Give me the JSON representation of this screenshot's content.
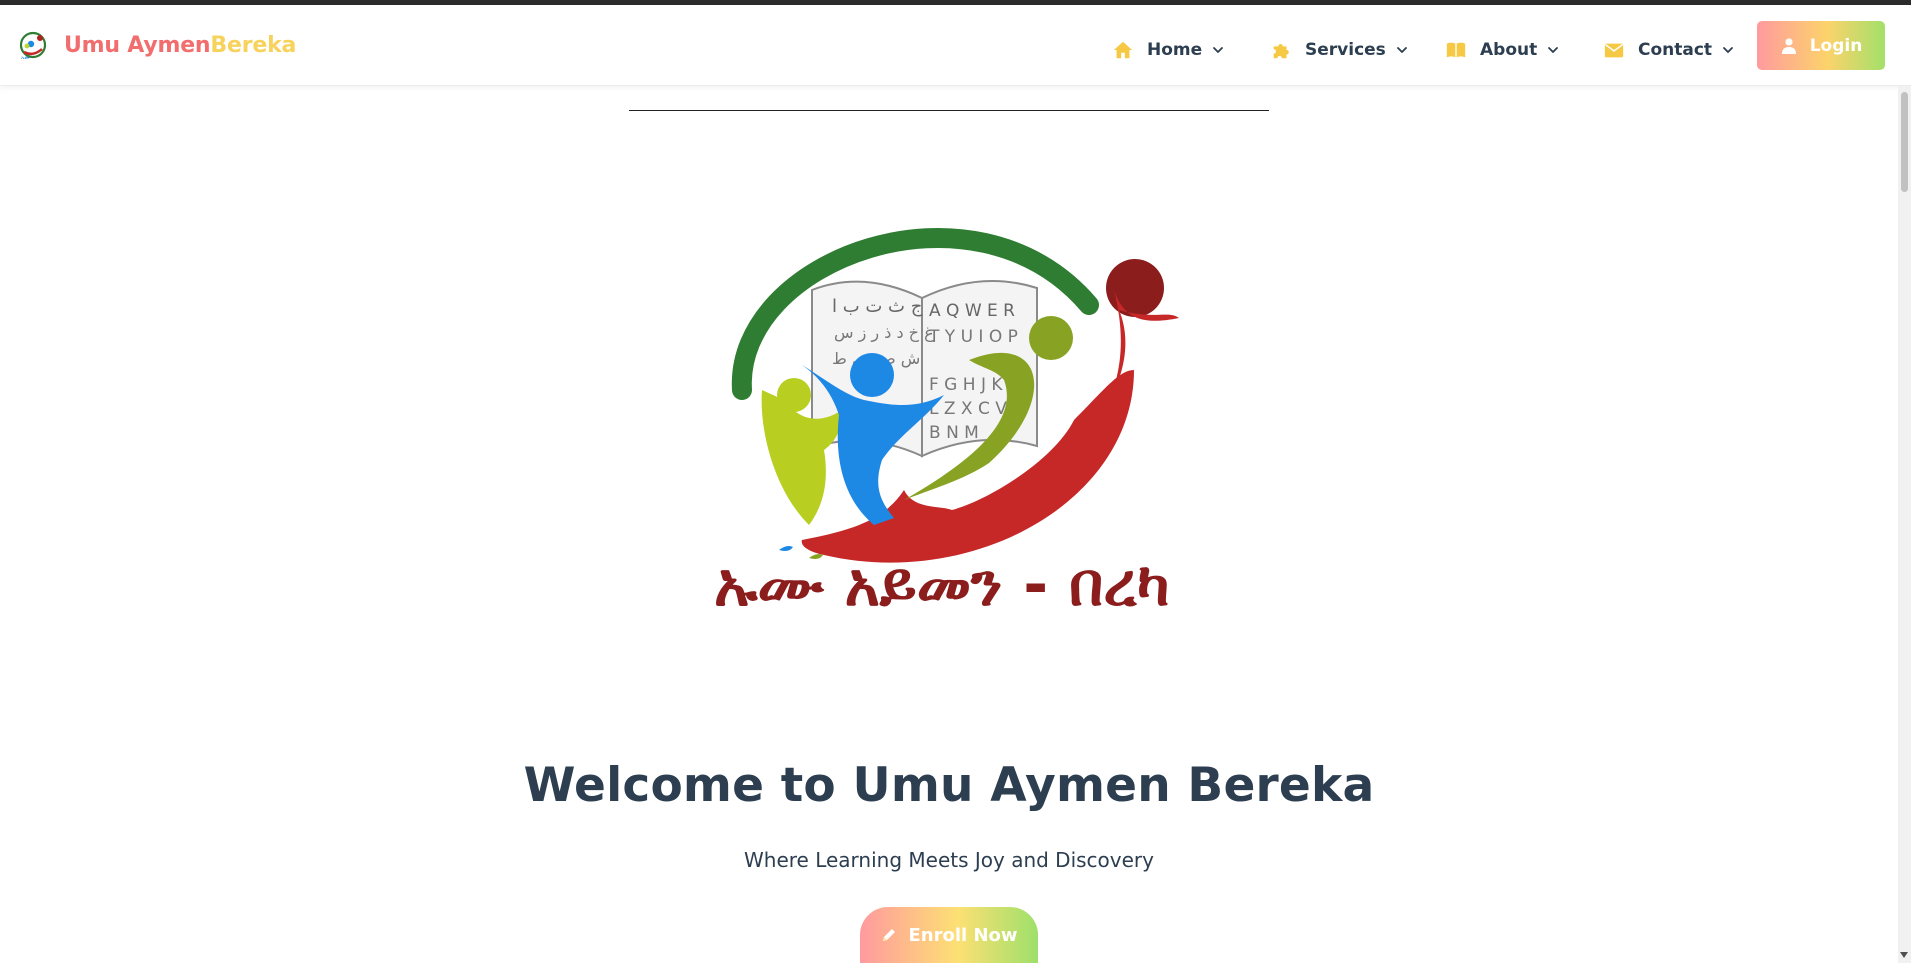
{
  "brand": {
    "name_part1": "Umu Aymen",
    "name_part2": "Bereka",
    "logo_icon": "school-globe-logo"
  },
  "nav": {
    "items": [
      {
        "label": "Home",
        "icon": "home-icon"
      },
      {
        "label": "Services",
        "icon": "puzzle-icon"
      },
      {
        "label": "About",
        "icon": "book-icon"
      },
      {
        "label": "Contact",
        "icon": "envelope-icon"
      }
    ],
    "login_label": "Login"
  },
  "hero": {
    "title": "Welcome to Umu Aymen Bereka",
    "subtitle": "Where Learning Meets Joy and Discovery",
    "cta_label": "Enroll Now",
    "logo_caption": "ኡሙ አይመን - በረካ",
    "book_left_text": "ج ث ت ب ا",
    "book_right_text": "A Q W E R"
  },
  "colors": {
    "brand_red": "#f26d6d",
    "brand_yellow": "#f7d25d",
    "heading": "#2c3e50",
    "gradient_start": "#ff9a9e",
    "gradient_mid": "#fcd36b",
    "gradient_end": "#a3e06a",
    "nav_icon": "#f6c945"
  }
}
